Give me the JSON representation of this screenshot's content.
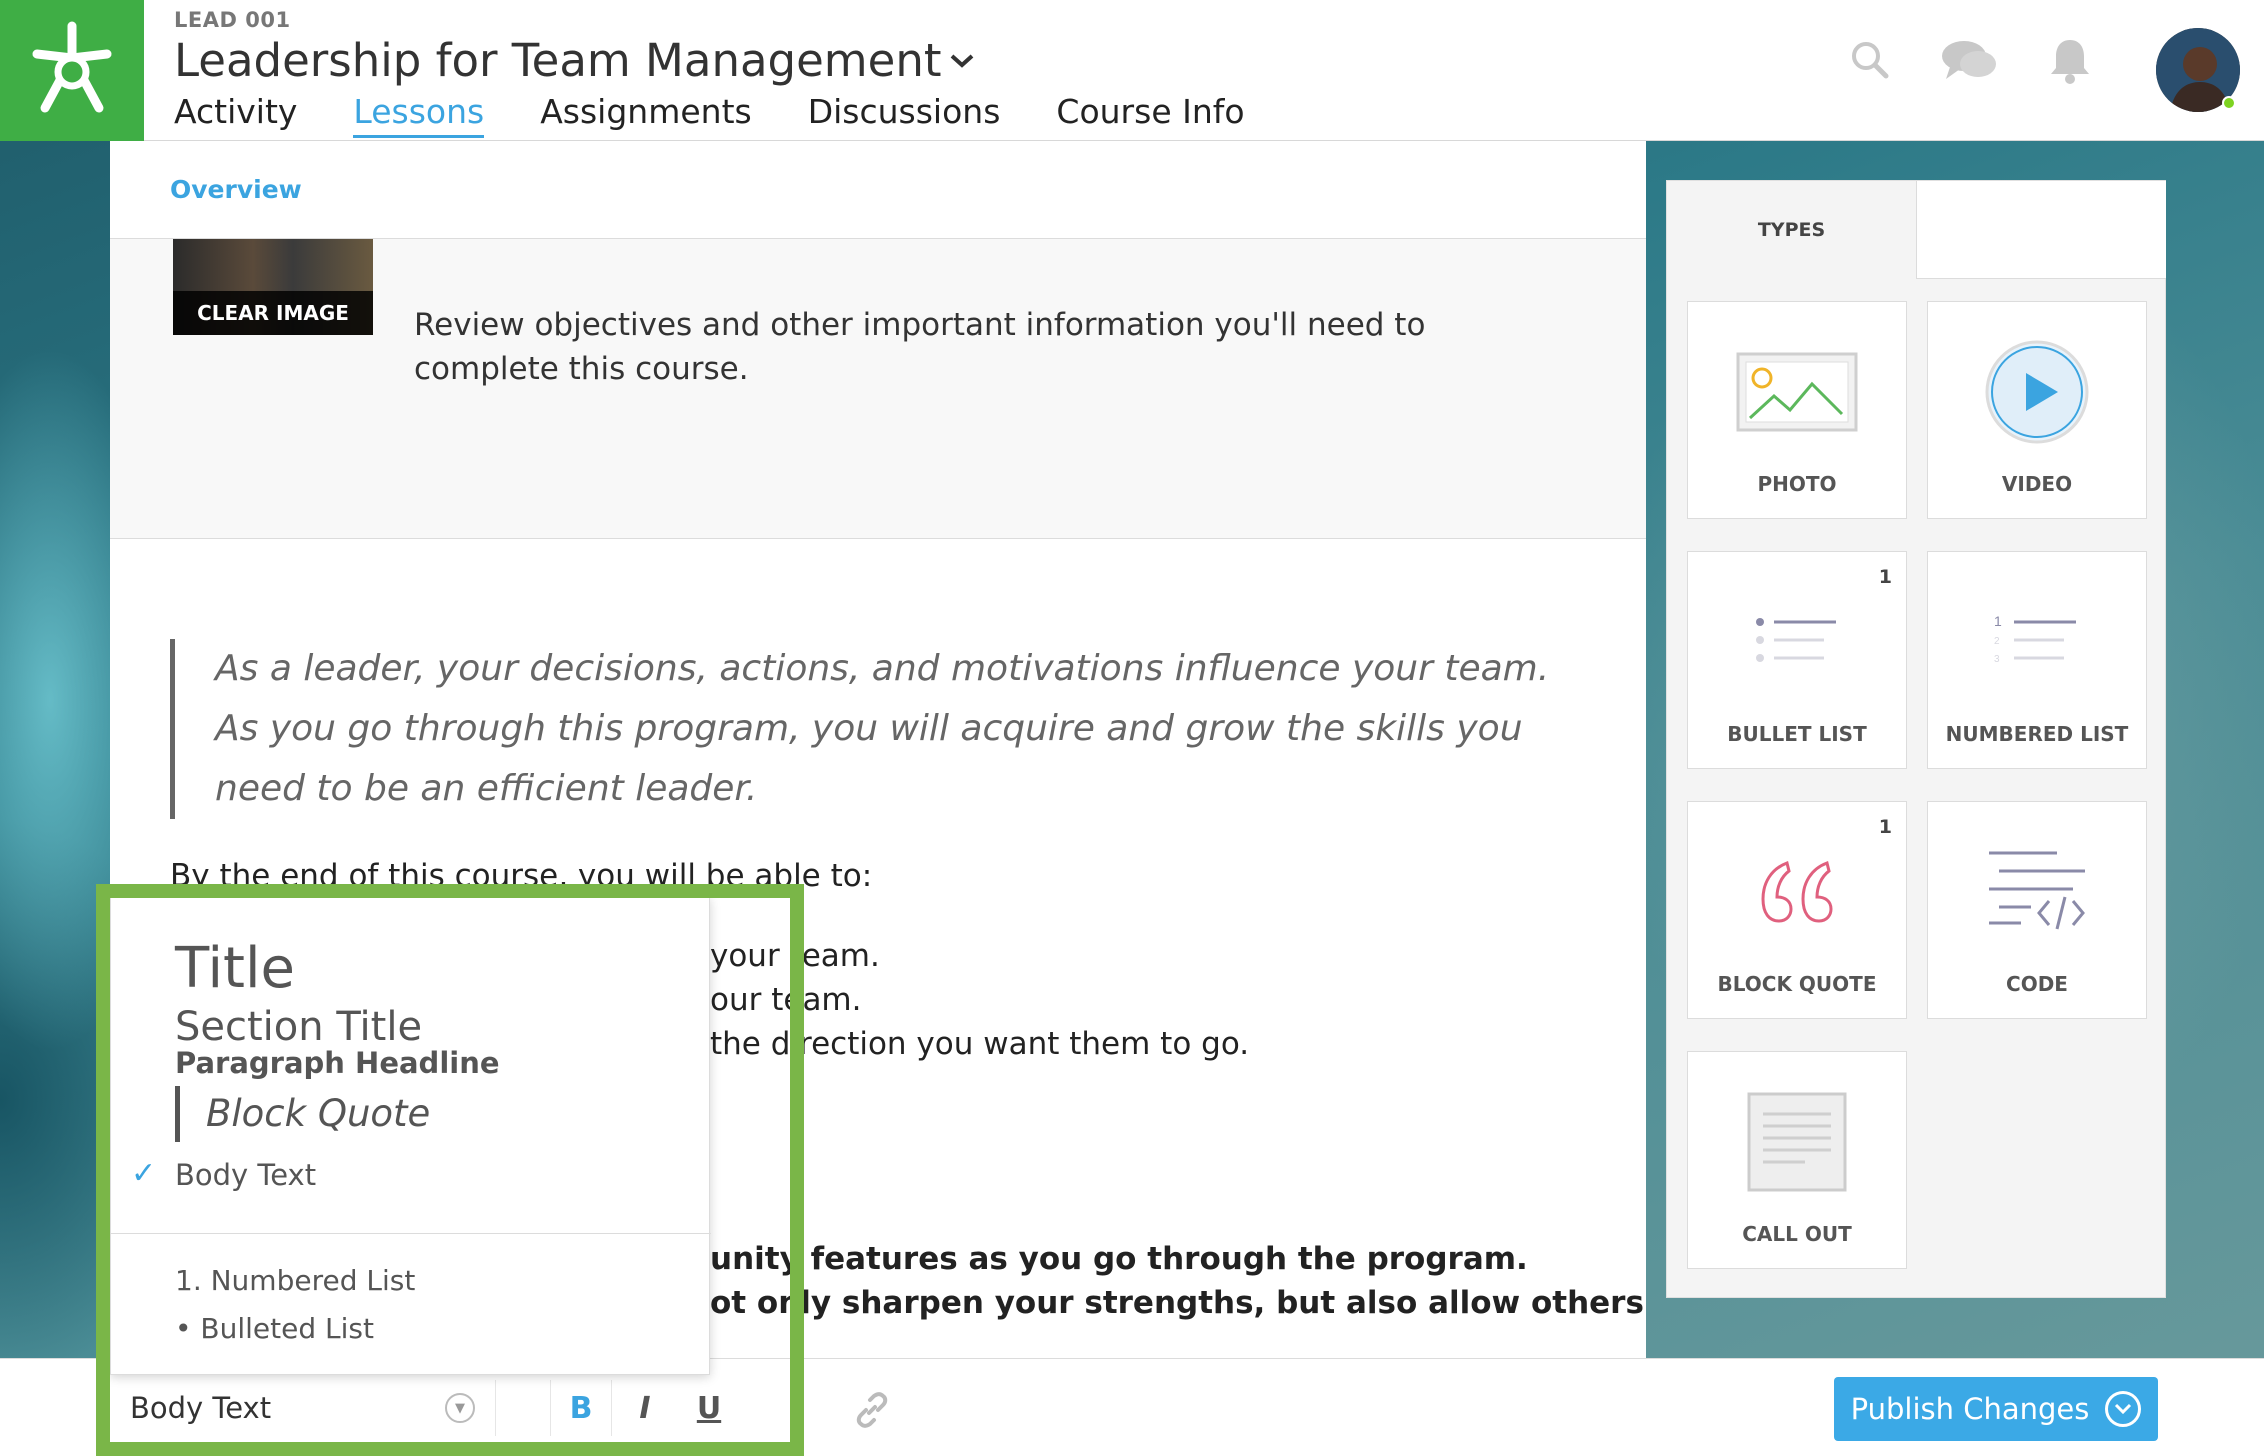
{
  "header": {
    "course_code": "LEAD 001",
    "course_title": "Leadership for Team Management",
    "tabs": [
      "Activity",
      "Lessons",
      "Assignments",
      "Discussions",
      "Course Info"
    ],
    "active_tab": "Lessons"
  },
  "breadcrumb": {
    "overview": "Overview"
  },
  "banner": {
    "clear_image": "CLEAR IMAGE",
    "text": "Review objectives and other important information you'll need to complete this course."
  },
  "content": {
    "quote": "As a leader, your decisions, actions, and motivations influence your team. As you go through this program, you will acquire and grow the skills you need to be an efficient leader.",
    "intro": "By the end of this course, you will be able to:",
    "line1": "your team.",
    "line2": "our team.",
    "line3": "the direction you want them to go.",
    "bold1": "unity features as you go through the program.",
    "bold2": "ot only sharpen your strengths, but also allow others"
  },
  "types_panel": {
    "tab_label": "TYPES",
    "tiles": [
      {
        "label": "PHOTO",
        "count": ""
      },
      {
        "label": "VIDEO",
        "count": ""
      },
      {
        "label": "BULLET LIST",
        "count": "1"
      },
      {
        "label": "NUMBERED LIST",
        "count": ""
      },
      {
        "label": "BLOCK QUOTE",
        "count": "1"
      },
      {
        "label": "CODE",
        "count": ""
      },
      {
        "label": "CALL OUT",
        "count": ""
      }
    ]
  },
  "style_menu": {
    "title": "Title",
    "section_title": "Section Title",
    "paragraph_headline": "Paragraph Headline",
    "block_quote": "Block Quote",
    "body_text": "Body Text",
    "check": "✓",
    "numbered_list": "1. Numbered List",
    "bulleted_list": "• Bulleted List",
    "selected": "Body Text"
  },
  "toolbar": {
    "style_value": "Body Text",
    "bold": "B",
    "italic": "I",
    "underline": "U",
    "publish": "Publish Changes"
  },
  "colors": {
    "accent": "#3ba4e0",
    "logo_green": "#3fae45",
    "highlight_green": "#7ab648",
    "quote_pink": "#e0607e"
  }
}
